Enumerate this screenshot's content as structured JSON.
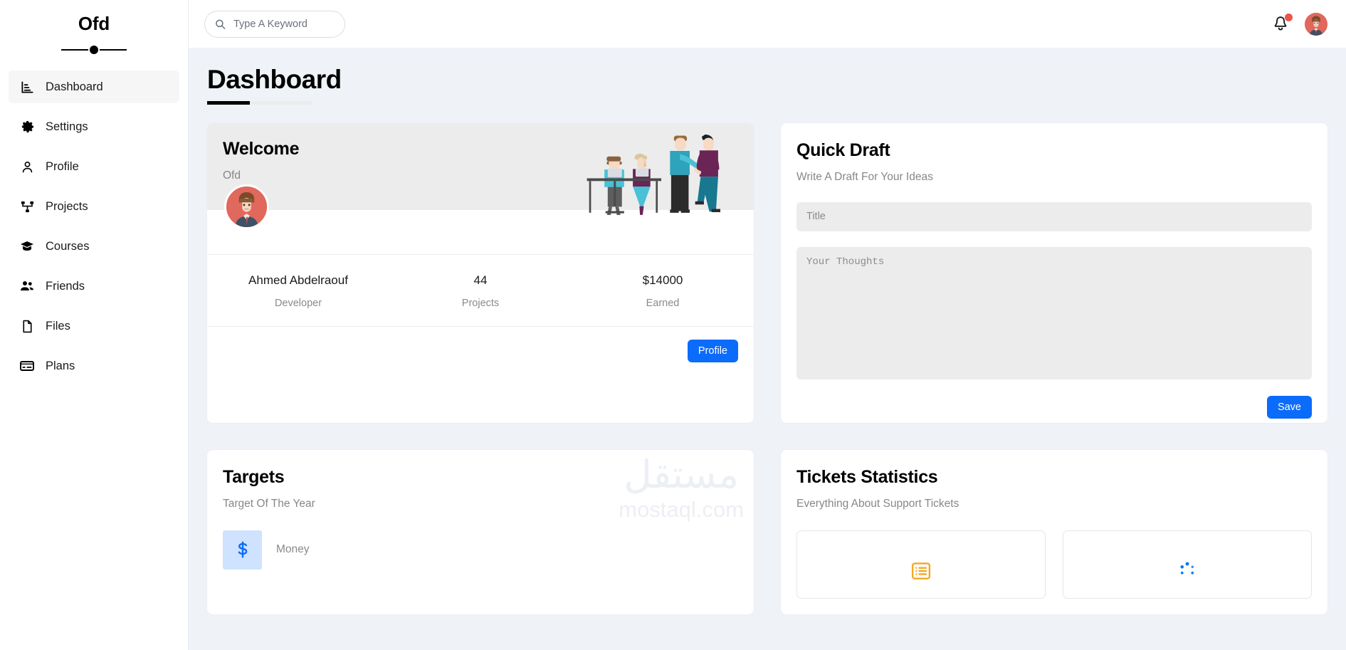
{
  "sidebar": {
    "brand": "Ofd",
    "items": [
      {
        "label": "Dashboard",
        "icon": "chart-bar-icon",
        "active": true
      },
      {
        "label": "Settings",
        "icon": "gear-icon",
        "active": false
      },
      {
        "label": "Profile",
        "icon": "user-icon",
        "active": false
      },
      {
        "label": "Projects",
        "icon": "sitemap-icon",
        "active": false
      },
      {
        "label": "Courses",
        "icon": "graduation-cap-icon",
        "active": false
      },
      {
        "label": "Friends",
        "icon": "users-icon",
        "active": false
      },
      {
        "label": "Files",
        "icon": "file-icon",
        "active": false
      },
      {
        "label": "Plans",
        "icon": "credit-card-icon",
        "active": false
      }
    ]
  },
  "topbar": {
    "search_placeholder": "Type A Keyword",
    "search_value": "",
    "search_icon": "search-icon",
    "bell_icon": "bell-icon",
    "has_notification": true,
    "avatar_icon": "user-avatar"
  },
  "page": {
    "title": "Dashboard"
  },
  "welcome": {
    "title": "Welcome",
    "subtitle": "Ofd",
    "illustration": "team-handshake-illustration",
    "avatar": "user-avatar",
    "stats": [
      {
        "value": "Ahmed Abdelraouf",
        "label": "Developer"
      },
      {
        "value": "44",
        "label": "Projects"
      },
      {
        "value": "$14000",
        "label": "Earned"
      }
    ],
    "button": "Profile"
  },
  "quick_draft": {
    "title": "Quick Draft",
    "subtitle": "Write A Draft For Your Ideas",
    "title_placeholder": "Title",
    "title_value": "",
    "body_placeholder": "Your Thoughts",
    "body_value": "",
    "button": "Save"
  },
  "targets": {
    "title": "Targets",
    "subtitle": "Target Of The Year",
    "rows": [
      {
        "label": "Money",
        "icon": "dollar-icon"
      }
    ]
  },
  "tickets": {
    "title": "Tickets Statistics",
    "subtitle": "Everything About Support Tickets",
    "boxes": [
      {
        "icon": "list-icon",
        "color": "#f5a623"
      },
      {
        "icon": "spinner-icon",
        "color": "#0d7bf0"
      }
    ]
  },
  "watermark": {
    "arabic": "مستقل",
    "latin": "mostaql.com"
  },
  "colors": {
    "accent": "#0b6bfb",
    "content_bg": "#eff2f7",
    "card_bg": "#ffffff",
    "muted": "#8a8a8a",
    "avatar_red": "#e0685c",
    "notif_red": "#e8564b",
    "orange": "#f5a623",
    "panel_gray": "#ececec"
  }
}
